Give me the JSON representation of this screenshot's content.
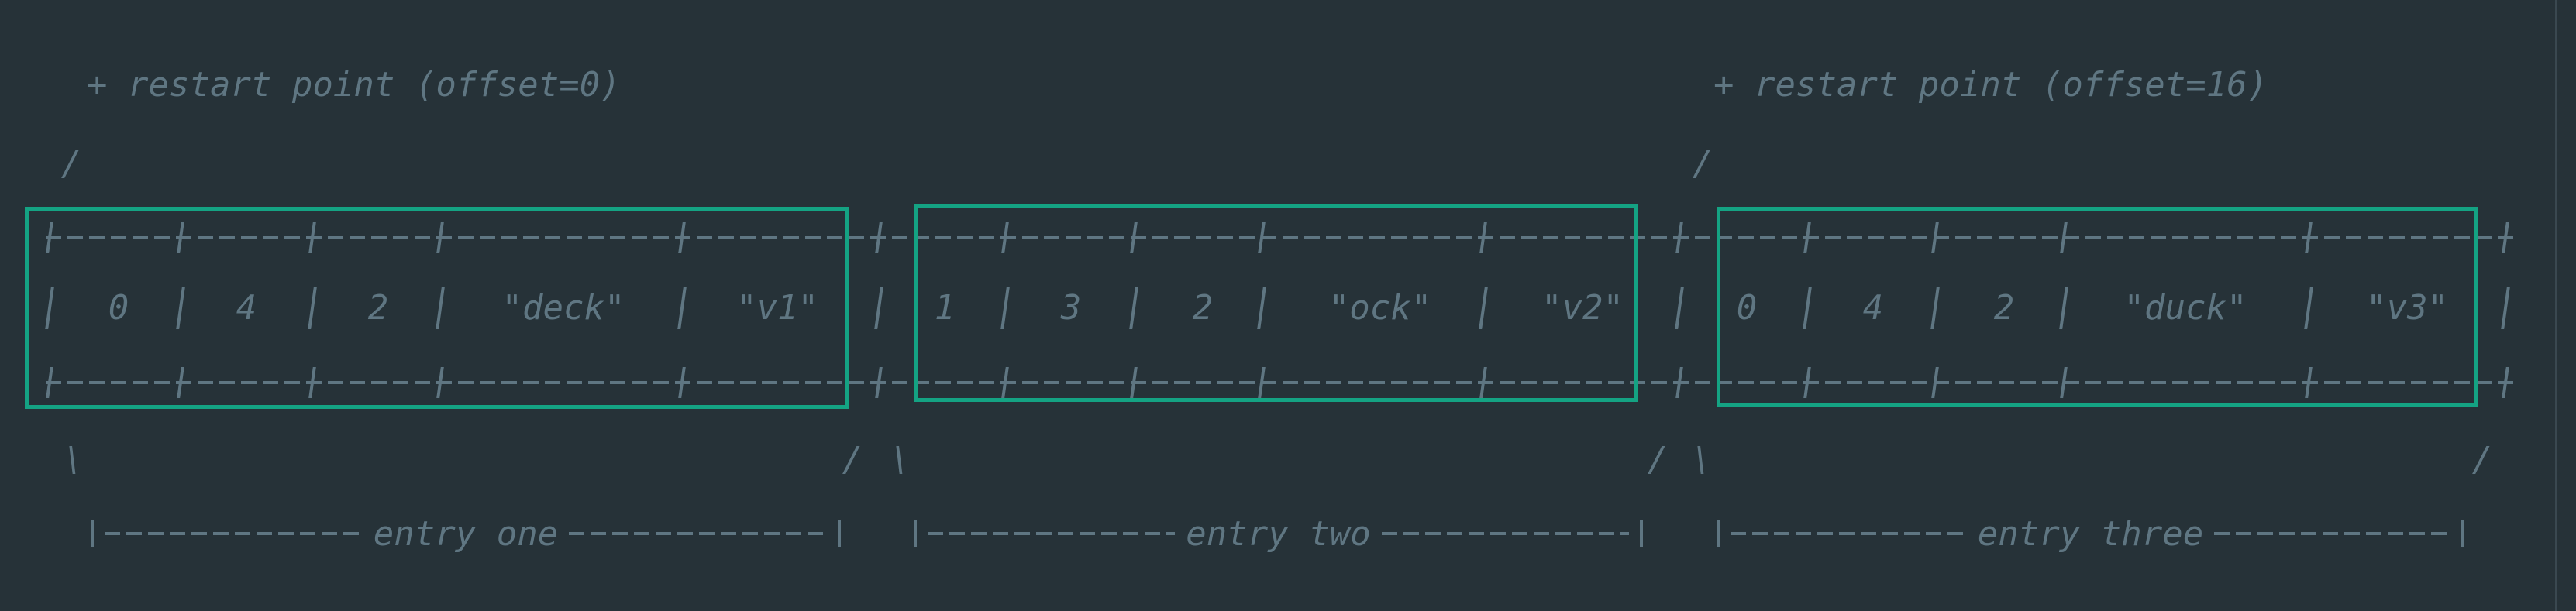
{
  "restart_points": [
    "+ restart point (offset=0)",
    "+ restart point (offset=16)"
  ],
  "entries": [
    {
      "cells": [
        "0",
        "4",
        "2",
        "\"deck\"",
        "\"v1\""
      ],
      "label": "entry one"
    },
    {
      "cells": [
        "1",
        "3",
        "2",
        "\"ock\"",
        "\"v2\""
      ],
      "label": "entry two"
    },
    {
      "cells": [
        "0",
        "4",
        "2",
        "\"duck\"",
        "\"v3\""
      ],
      "label": "entry three"
    }
  ],
  "slash": "/",
  "backslash": "\\",
  "colors": {
    "background": "#263238",
    "text": "#5f7682",
    "highlight": "#14a383"
  }
}
